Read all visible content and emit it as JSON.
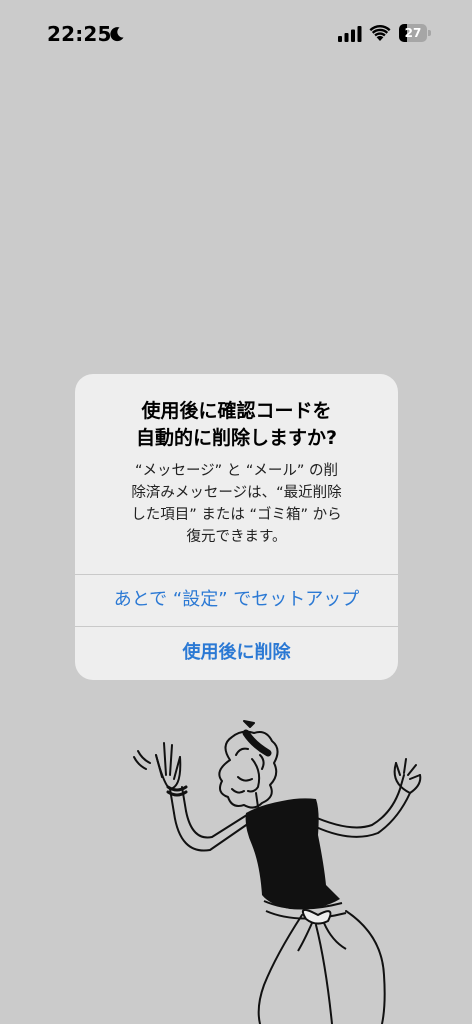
{
  "status_bar": {
    "time": "22:25",
    "battery_level": "27",
    "battery_fraction": 0.27,
    "icons": [
      "moon-icon",
      "cellular-signal-icon",
      "wifi-icon",
      "battery-icon"
    ]
  },
  "alert": {
    "title_line1": "使用後に確認コードを",
    "title_line2": "自動的に削除しますか?",
    "message_line1": "“メッセージ” と “メール” の削",
    "message_line2": "除済みメッセージは、“最近削除",
    "message_line3": "した項目” または “ゴミ箱” から",
    "message_line4": "復元できます。",
    "buttons": [
      {
        "label": "あとで “設定” でセットアップ",
        "bold": false
      },
      {
        "label": "使用後に削除",
        "bold": true
      }
    ]
  },
  "colors": {
    "background": "#cbcbcb",
    "alert_background": "#eeeeee",
    "action_blue": "#2b79d4"
  }
}
